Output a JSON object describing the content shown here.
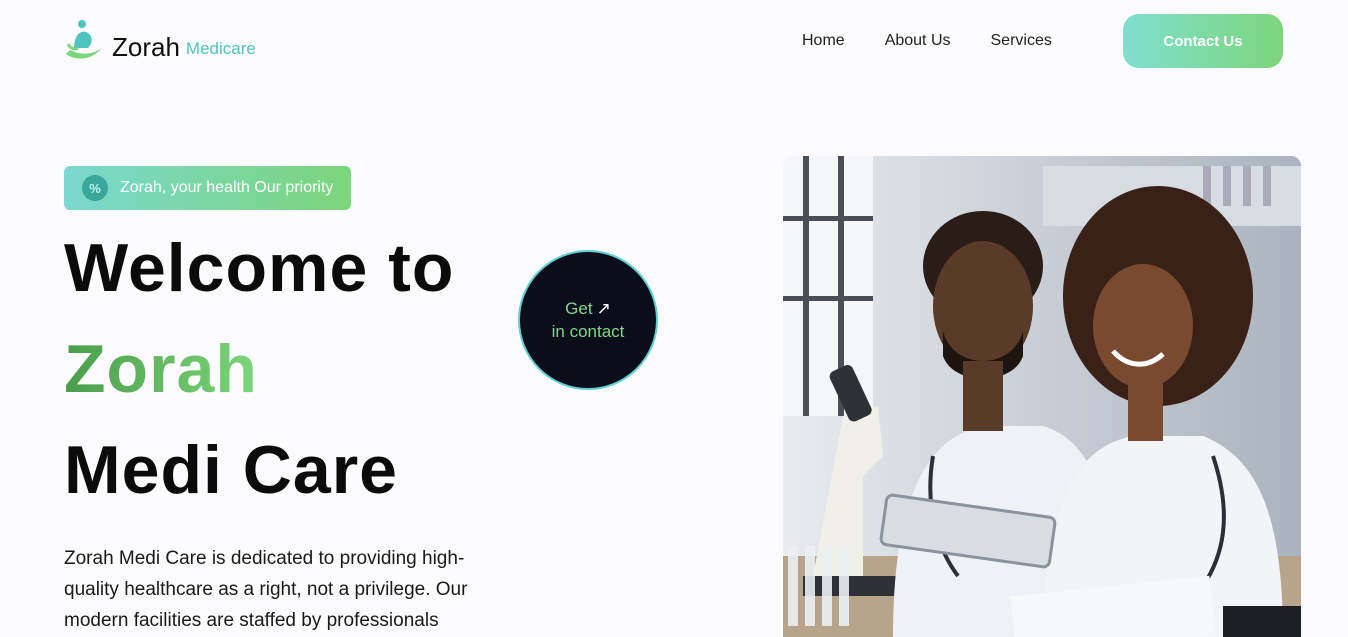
{
  "header": {
    "logo_name": "Zorah",
    "logo_sub": "Medicare",
    "nav": [
      "Home",
      "About Us",
      "Services"
    ],
    "contact_label": "Contact Us"
  },
  "hero": {
    "tagline": "Zorah, your health Our priority",
    "tag_icon": "%",
    "title_line1": "Welcome to",
    "title_line2": "Zorah",
    "title_line3": "Medi Care",
    "description": "Zorah Medi Care is dedicated to providing high-quality healthcare as a right, not a privilege. Our modern facilities are staffed by professionals",
    "cta_line1": "Get",
    "cta_line2": "in contact",
    "cta_arrow": "↗"
  },
  "colors": {
    "accent_teal": "#7fdfd0",
    "accent_green": "#7cd67a",
    "dark": "#0b0d1a"
  },
  "icons": {
    "logo": "person-hand-logo-icon",
    "tag": "percent-badge-icon",
    "cta": "arrow-up-right-icon"
  }
}
